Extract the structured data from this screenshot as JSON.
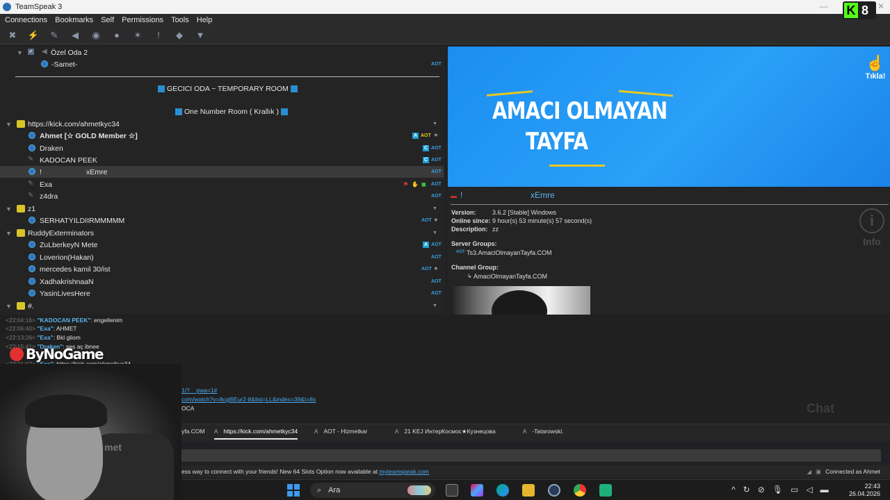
{
  "window": {
    "title": "TeamSpeak 3"
  },
  "overlay": {
    "kick_letter": "K",
    "kick_count": "8"
  },
  "menu": [
    "Connections",
    "Bookmarks",
    "Self",
    "Permissions",
    "Tools",
    "Help"
  ],
  "tree": {
    "rows": [
      {
        "type": "channel-sub",
        "label": "Özel Oda 2"
      },
      {
        "type": "user",
        "label": "-Samet-",
        "badge": "AOT"
      },
      {
        "type": "spacer",
        "label": "GECICI ODA ~ TEMPORARY ROOM"
      },
      {
        "type": "spacer",
        "label": "One Number Room ( Krallık )"
      },
      {
        "type": "channel",
        "label": "https://kick.com/ahmetkyc34"
      },
      {
        "type": "user",
        "label": "Ahmet [☆ GOLD Member ☆]",
        "badge": "AOT",
        "extra": "A"
      },
      {
        "type": "user",
        "label": "Draken",
        "badge": "AOT",
        "extra": "C"
      },
      {
        "type": "user-muted",
        "label": "KADOCAN PEEK",
        "badge": "AOT",
        "extra": "C"
      },
      {
        "type": "user-selected",
        "label": "!",
        "label2": "xEmre",
        "badge": "AOT"
      },
      {
        "type": "user-muted",
        "label": "Exa",
        "badge": "AOT"
      },
      {
        "type": "user-muted",
        "label": "z4dra",
        "badge": "AOT"
      },
      {
        "type": "channel",
        "label": "z1"
      },
      {
        "type": "user",
        "label": "SERHATYILDIIRMMMMM",
        "badge": "AOT"
      },
      {
        "type": "channel",
        "label": "RuddyExterminators"
      },
      {
        "type": "user",
        "label": "ZuLberkeyN Mete",
        "badge": "AOT",
        "extra": "A"
      },
      {
        "type": "user",
        "label": "Loverion(Hakan)",
        "badge": "AOT"
      },
      {
        "type": "user",
        "label": "mercedes kamil 30/ist",
        "badge": "AOT"
      },
      {
        "type": "user",
        "label": "XadhakrishnaaN",
        "badge": "AOT"
      },
      {
        "type": "user",
        "label": "YasinLivesHere",
        "badge": "AOT"
      },
      {
        "type": "channel",
        "label": "#."
      }
    ]
  },
  "banner": {
    "line1": "AMACI OLMAYAN",
    "line2": "TAYFA",
    "click_label": "Tıkla!"
  },
  "info": {
    "name_prefix": "!",
    "name": "xEmre",
    "version_k": "Version:",
    "version_v": "3.6.2 [Stable] Windows",
    "online_k": "Online since:",
    "online_v": "9 hour(s) 53 minute(s) 57 second(s)",
    "desc_k": "Description:",
    "desc_v": "zz",
    "server_groups_k": "Server Groups:",
    "server_group_badge": "AOT",
    "server_group": "Ts3.AmaciOlmayanTayfa.COM",
    "channel_group_k": "Channel Group:",
    "channel_group": "AmaciOlmayanTayfa.COM",
    "side_info": "Info",
    "chat_watermark": "Chat"
  },
  "chat": {
    "lines": [
      {
        "ts": "<22:04:16>",
        "name": "\"KADOCAN PEEK\"",
        "text": ": engellenim"
      },
      {
        "ts": "<22:06:40>",
        "name": "\"Exa\"",
        "text": ": AHMET"
      },
      {
        "ts": "<22:13:26>",
        "name": "\"Exa\"",
        "text": ": Bkl gliom"
      },
      {
        "ts": "<22:15:41>",
        "name": "\"Draken\"",
        "text": ": ses aç ibnee"
      },
      {
        "ts": "<22:21:02>",
        "name": "\"Exa\"",
        "text": ": https://kick.com/ahmetkyc34"
      }
    ],
    "link1": "1/?__pwa=1#",
    "link2": "com/watch?v=8cgl6Eur2-8&list=LL&index=39&t=8s",
    "tail": "OCA"
  },
  "logo": {
    "text": "ByNoGame"
  },
  "webcam": {
    "shirt_text": "met"
  },
  "tabs": [
    {
      "label": "yfa.COM",
      "icon": ""
    },
    {
      "label": "https://kick.com/ahmetkyc34",
      "icon": "A",
      "active": true
    },
    {
      "label": "AOT - Hizmetkar",
      "icon": "A"
    },
    {
      "label": "21 KEJ ИнтерКосмос★Кузнецова",
      "icon": "A"
    },
    {
      "label": "-Tatarowski.",
      "icon": "A"
    }
  ],
  "status": {
    "message_prefix": "ess way to connect with your friends! New 64 Slots Option now available at ",
    "message_link": "myteamspeak.com",
    "connection": "Connected as Ahmet"
  },
  "taskbar": {
    "search_placeholder": "Ara",
    "time": "22:43",
    "date": "26.04.2026"
  },
  "colors": {
    "accent": "#2a9df4",
    "banner_blue": "#1b8ef0",
    "badge_blue": "#3aa0e0",
    "channel_yellow": "#d7c52a"
  }
}
